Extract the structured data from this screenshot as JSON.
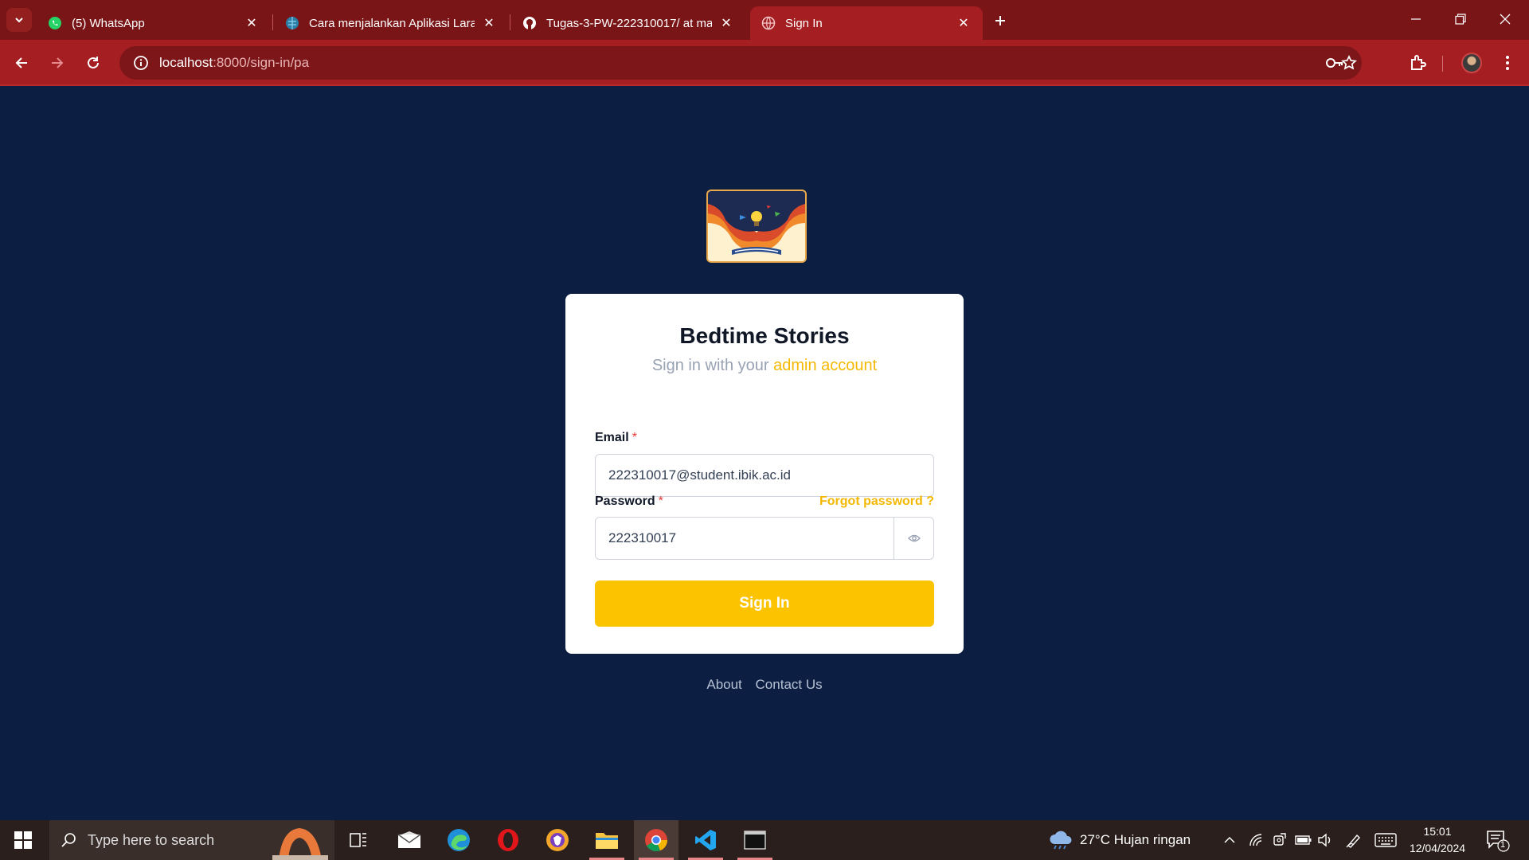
{
  "browser": {
    "tabs": [
      {
        "title": "(5) WhatsApp",
        "icon": "whatsapp-icon",
        "active": false
      },
      {
        "title": "Cara menjalankan Aplikasi Larav",
        "icon": "globe-icon",
        "active": false
      },
      {
        "title": "Tugas-3-PW-222310017/ at ma",
        "icon": "github-icon",
        "active": false
      },
      {
        "title": "Sign In",
        "icon": "globe-icon",
        "active": true
      }
    ],
    "url_host": "localhost",
    "url_path": ":8000/sign-in/pa"
  },
  "page": {
    "title": "Bedtime Stories",
    "subtitle_prefix": "Sign in with your ",
    "subtitle_accent": "admin account",
    "email_label": "Email",
    "email_required": "*",
    "email_value": "222310017@student.ibik.ac.id",
    "password_label": "Password",
    "password_required": "*",
    "forgot_label": "Forgot password ?",
    "password_value": "222310017",
    "signin_label": "Sign In",
    "footer_about": "About",
    "footer_contact": "Contact Us",
    "colors": {
      "background": "#0c1f42",
      "accent": "#fcc300",
      "card": "#ffffff"
    }
  },
  "taskbar": {
    "search_placeholder": "Type here to search",
    "weather": "27°C  Hujan ringan",
    "time": "15:01",
    "date": "12/04/2024",
    "notification_count": "1"
  }
}
